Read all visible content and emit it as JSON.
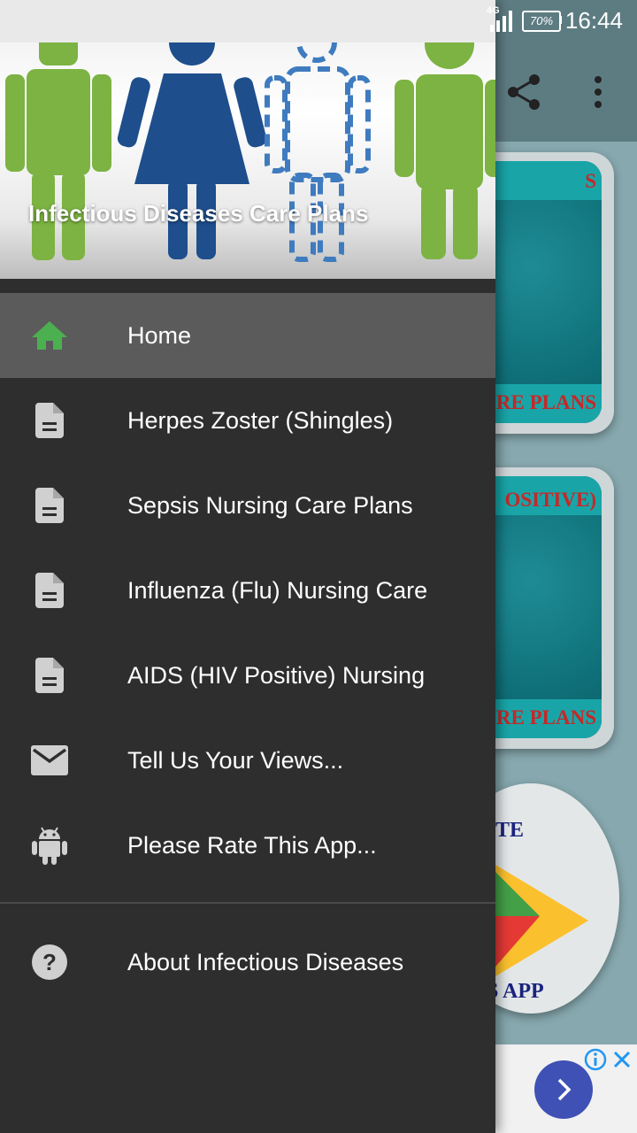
{
  "status_bar": {
    "network": "4G",
    "battery": "70%",
    "time": "16:44"
  },
  "drawer": {
    "header_title": "Infectious Diseases Care Plans",
    "items": [
      {
        "label": "Home",
        "icon": "home-icon",
        "active": true
      },
      {
        "label": "Herpes Zoster (Shingles)",
        "icon": "document-icon"
      },
      {
        "label": "Sepsis Nursing Care Plans",
        "icon": "document-icon"
      },
      {
        "label": "Influenza (Flu) Nursing Care",
        "icon": "document-icon"
      },
      {
        "label": "AIDS (HIV Positive) Nursing",
        "icon": "document-icon"
      },
      {
        "label": "Tell Us Your Views...",
        "icon": "mail-icon"
      },
      {
        "label": "Please Rate This App...",
        "icon": "android-icon"
      }
    ],
    "about": {
      "label": "About Infectious Diseases",
      "icon": "help-icon"
    }
  },
  "background": {
    "card1_top": "S",
    "card1_bottom": "RE PLANS",
    "card2_top": "OSITIVE)",
    "card2_bottom": "RE PLANS",
    "rate_top": "TE",
    "rate_bottom": "S APP"
  },
  "colors": {
    "drawer_bg": "#2e2e2e",
    "active_item_bg": "#5b5b5b",
    "home_icon": "#4caf50",
    "icon_gray": "#d0d0d0",
    "card_text": "#c62828"
  }
}
